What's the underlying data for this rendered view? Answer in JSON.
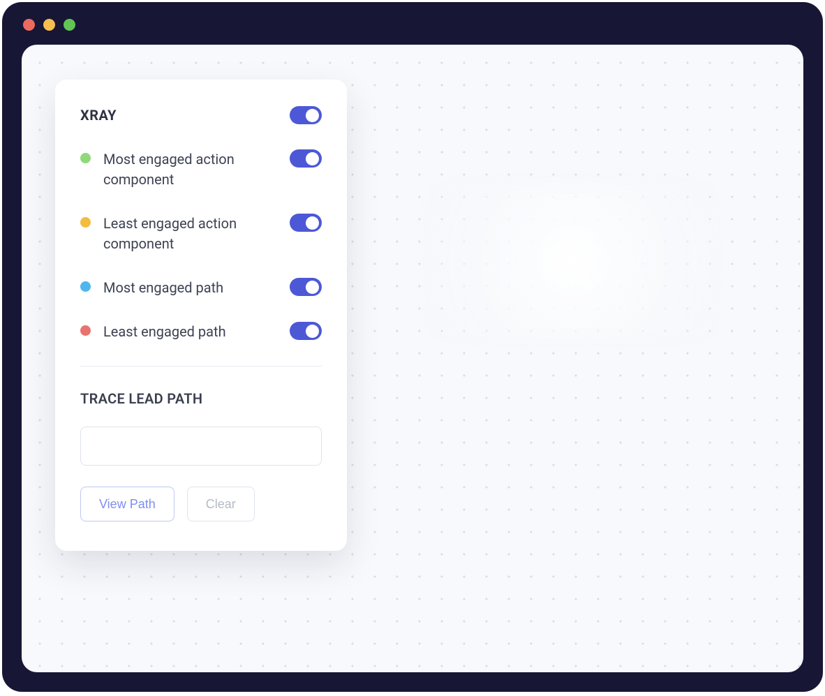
{
  "window": {
    "dot_colors": {
      "close": "#EC6A5E",
      "minimize": "#F5BF4F",
      "maximize": "#61C554"
    }
  },
  "panel": {
    "title": "XRAY",
    "main_toggle": true,
    "options": [
      {
        "label": "Most engaged action component",
        "dot_color": "#8FD97A",
        "on": true
      },
      {
        "label": "Least engaged action component",
        "dot_color": "#F3BC3F",
        "on": true
      },
      {
        "label": "Most engaged path",
        "dot_color": "#4FB7EE",
        "on": true
      },
      {
        "label": "Least engaged path",
        "dot_color": "#E8736F",
        "on": true
      }
    ],
    "trace_section_title": "TRACE LEAD PATH",
    "trace_input_value": "",
    "trace_input_placeholder": "",
    "view_path_label": "View Path",
    "clear_label": "Clear"
  },
  "colors": {
    "toggle_on": "#4D58D6",
    "panel_bg": "#FFFFFF",
    "canvas_bg": "#F7F9FC",
    "frame_bg": "#171635"
  }
}
